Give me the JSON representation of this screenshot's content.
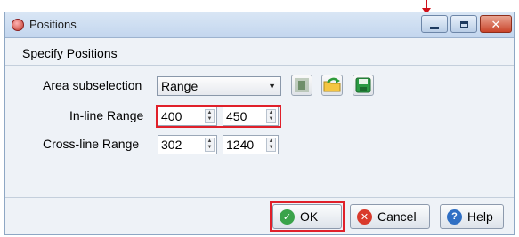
{
  "window": {
    "title": "Positions"
  },
  "section": {
    "title": "Specify Positions"
  },
  "area": {
    "label": "Area subselection",
    "selected": "Range"
  },
  "inline": {
    "label": "In-line Range",
    "from": "400",
    "to": "450"
  },
  "crossline": {
    "label": "Cross-line Range",
    "from": "302",
    "to": "1240"
  },
  "buttons": {
    "ok": "OK",
    "cancel": "Cancel",
    "help": "Help"
  },
  "icons": {
    "app": "app-logo-icon",
    "tool1": "select-area-icon",
    "tool2": "open-folder-icon",
    "tool3": "save-disk-icon",
    "ok": "checkmark-icon",
    "cancel": "cancel-x-icon",
    "help": "help-question-icon"
  },
  "colors": {
    "highlight": "#e0202a",
    "title_bar": "#c3d6ee",
    "close_button": "#c9442a"
  }
}
